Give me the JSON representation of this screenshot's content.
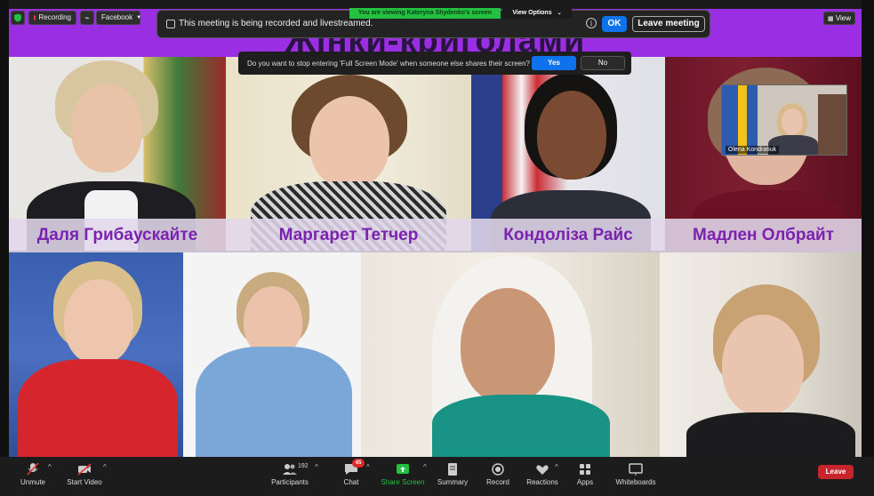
{
  "slide": {
    "title": "Жінки-криголами",
    "captions": [
      "Даля Грибаускайте",
      "Маргарет Тетчер",
      "Кондоліза Райс",
      "Мадлен Олбрайт"
    ]
  },
  "top_bar": {
    "recording_label": "Recording",
    "facebook_label": "Facebook",
    "view_label": "View"
  },
  "recording_banner": {
    "message": "This meeting is being recorded and livestreamed.",
    "info_glyph": "i",
    "ok_label": "OK",
    "leave_label": "Leave meeting"
  },
  "share_banner": {
    "viewing_text": "You are viewing Kateryna Shydenko's screen",
    "view_options_label": "View Options"
  },
  "fullscreen_prompt": {
    "question": "Do you want to stop entering 'Full Screen Mode' when someone else shares their screen?",
    "yes_label": "Yes",
    "no_label": "No"
  },
  "self_view": {
    "name": "Olena Kondratiuk"
  },
  "toolbar": {
    "unmute_label": "Unmute",
    "start_video_label": "Start Video",
    "participants_label": "Participants",
    "participants_count": "192",
    "chat_label": "Chat",
    "chat_badge": "45",
    "share_screen_label": "Share Screen",
    "summary_label": "Summary",
    "record_label": "Record",
    "reactions_label": "Reactions",
    "apps_label": "Apps",
    "whiteboards_label": "Whiteboards",
    "leave_label": "Leave"
  },
  "colors": {
    "accent_blue": "#0e72ed",
    "leave_red": "#c7252b",
    "share_green": "#23c041",
    "slide_purple": "#9a2ee3",
    "caption_text": "#7b22b0"
  }
}
